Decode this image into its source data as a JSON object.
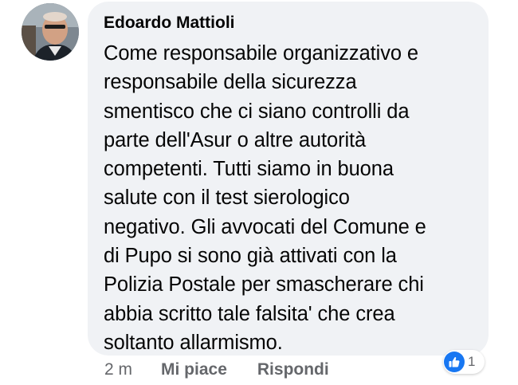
{
  "comment": {
    "author": "Edoardo Mattioli",
    "text_lines": [
      "Come responsabile organizzativo e",
      "responsabile della sicurezza",
      "smentisco che ci siano controlli da",
      "parte dell'Asur o altre autorità",
      "competenti. Tutti siamo in buona",
      "salute con il test sierologico",
      "negativo. Gli avvocati del Comune e",
      "di Pupo si sono già attivati con la",
      "Polizia Postale per smascherare chi",
      "abbia scritto tale falsita' che crea",
      "soltanto allarmismo."
    ],
    "timestamp": "2 m",
    "like_label": "Mi piace",
    "reply_label": "Rispondi",
    "reaction_count": "1",
    "reaction_icon": "thumbs-up-icon",
    "accent_color": "#1877f2",
    "bubble_color": "#f0f2f5"
  }
}
